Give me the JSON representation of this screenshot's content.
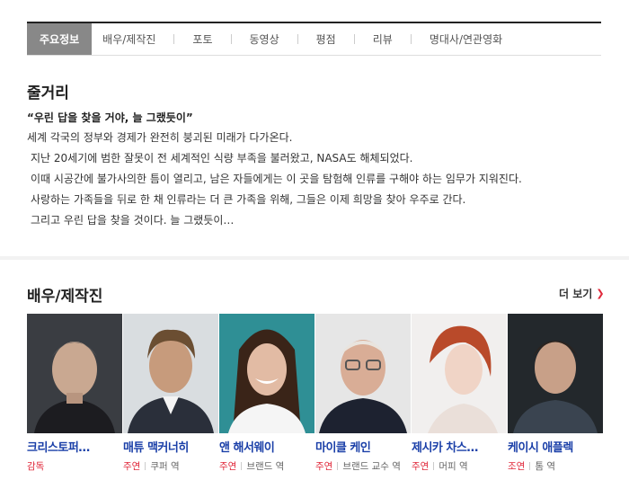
{
  "tabs": [
    {
      "label": "주요정보",
      "active": true
    },
    {
      "label": "배우/제작진",
      "active": false
    },
    {
      "label": "포토",
      "active": false
    },
    {
      "label": "동영상",
      "active": false
    },
    {
      "label": "평점",
      "active": false
    },
    {
      "label": "리뷰",
      "active": false
    },
    {
      "label": "명대사/연관영화",
      "active": false
    }
  ],
  "synopsis": {
    "title": "줄거리",
    "tagline": "“우린 답을 찾을 거야, 늘 그랬듯이”",
    "lines": [
      "세계 각국의 정부와 경제가 완전히 붕괴된 미래가 다가온다.",
      "지난 20세기에 범한 잘못이 전 세계적인 식량 부족을 불러왔고, NASA도 해체되었다.",
      "이때 시공간에 불가사의한 틈이 열리고, 남은 자들에게는 이 곳을 탐험해 인류를 구해야 하는 임무가 지워진다.",
      "사랑하는 가족들을 뒤로 한 채 인류라는 더 큰 가족을 위해, 그들은 이제 희망을 찾아 우주로 간다.",
      "그리고 우린 답을 찾을 것이다. 늘 그랬듯이…"
    ]
  },
  "cast": {
    "title": "배우/제작진",
    "more_label": "더 보기",
    "more_icon": "chevron-right-icon",
    "members": [
      {
        "name": "크리스토퍼…",
        "part": "감독",
        "role": ""
      },
      {
        "name": "매튜 맥커너히",
        "part": "주연",
        "role": "쿠퍼 역"
      },
      {
        "name": "앤 해서웨이",
        "part": "주연",
        "role": "브랜드 역"
      },
      {
        "name": "마이클 케인",
        "part": "주연",
        "role": "브랜드 교수 역"
      },
      {
        "name": "제시카 차스…",
        "part": "주연",
        "role": "머피 역"
      },
      {
        "name": "케이시 애플렉",
        "part": "조연",
        "role": "톰 역"
      }
    ]
  },
  "colors": {
    "accent_red": "#e0283a",
    "name_blue": "#1a3fa8",
    "active_tab_bg": "#888888"
  }
}
